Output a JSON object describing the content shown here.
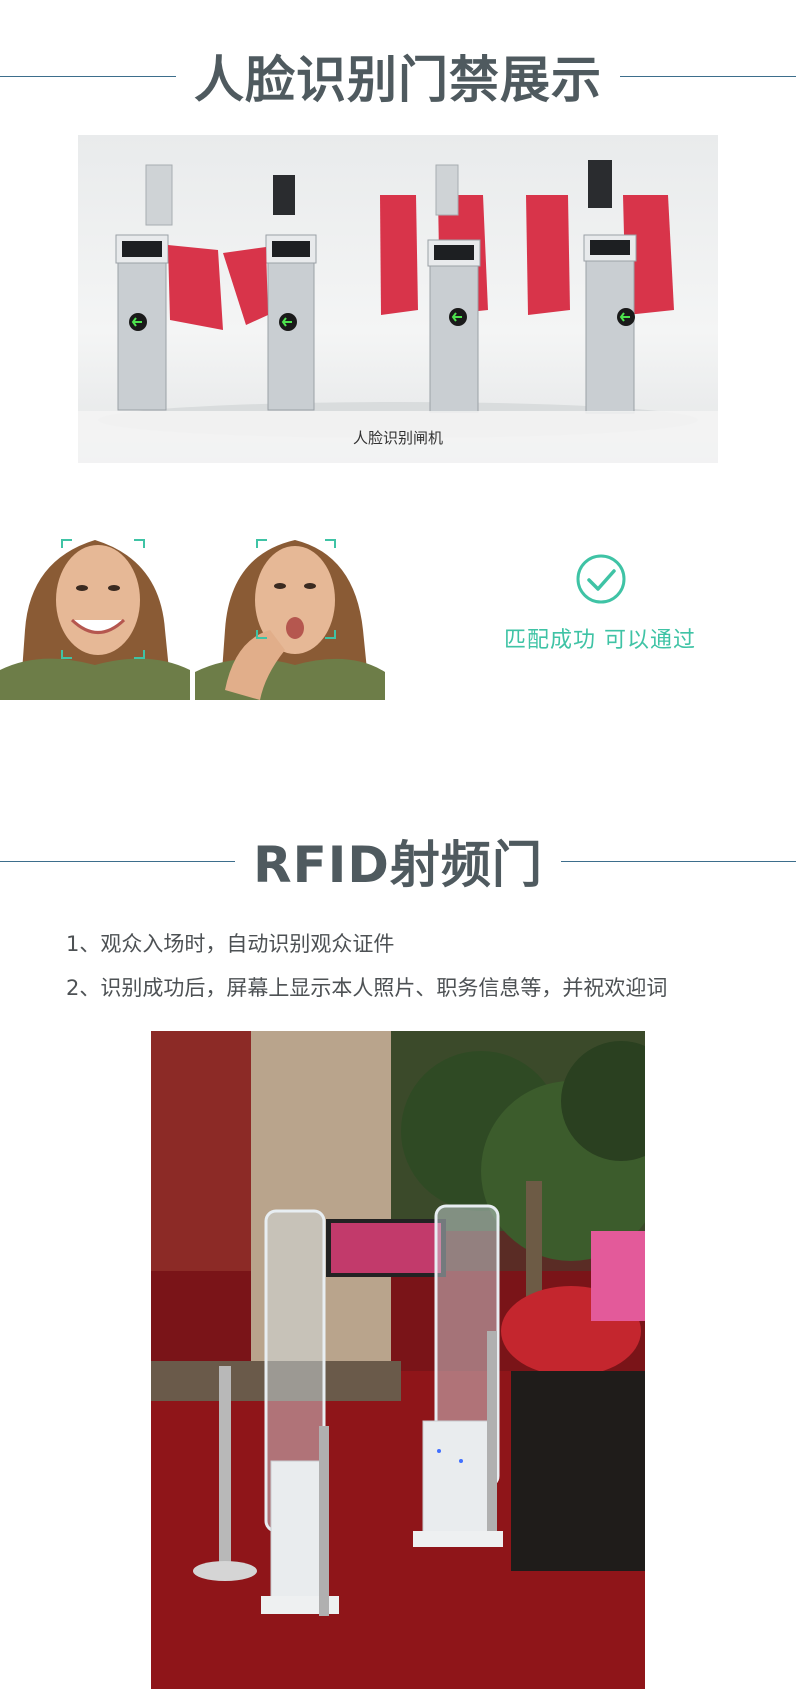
{
  "section_face": {
    "title": "人脸识别门禁展示",
    "gate_caption": "人脸识别闸机",
    "match_text": "匹配成功  可以通过"
  },
  "section_rfid": {
    "title": "RFID射频门",
    "items": [
      "1、观众入场时，自动识别观众证件",
      "2、识别成功后，屏幕上显示本人照片、职务信息等，并祝欢迎词"
    ]
  },
  "colors": {
    "rule": "#3d6e8c",
    "title": "#4f5a5f",
    "accent_green": "#3fc3a5",
    "gate_red": "#d8344a"
  },
  "icons": [
    "check-circle-icon",
    "arrow-left-icon",
    "face-frame-icon"
  ]
}
